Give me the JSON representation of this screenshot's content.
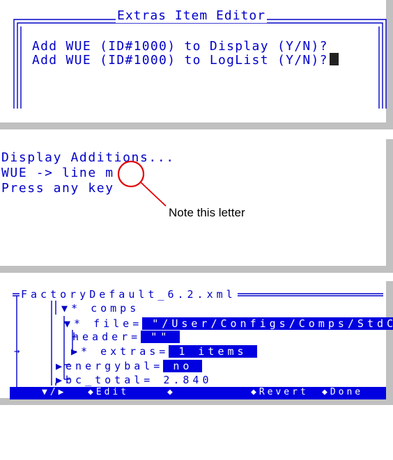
{
  "panel1": {
    "title": "Extras Item Editor",
    "line1": "Add WUE (ID#1000) to Display (Y/N)?",
    "line2": "Add WUE (ID#1000) to LogList (Y/N)?"
  },
  "panel2": {
    "line1": "Display Additions...",
    "line2_prefix": "WUE -> line ",
    "line2_letter": "m",
    "line3": "Press any key",
    "annotation": "Note this letter"
  },
  "panel3": {
    "title": "FactoryDefault_6.2.xml",
    "comps_label": "▼* comps",
    "file_label": "▼* file=",
    "file_value": " \"/User/Configs/Comps/StdCo",
    "header_label": "header=",
    "header_value": " \"\" ",
    "extras_label": "▶* extras=",
    "extras_value": " 1 items ",
    "energybal_label": "▶energybal=",
    "energybal_value": " no ",
    "bc_total_label": "▶bc_total=",
    "bc_total_value": " 2.840",
    "cursor_arrow": "→",
    "footer": {
      "toggle": "▼/▶",
      "edit": "◆Edit",
      "diamond": "◆",
      "revert": "◆Revert",
      "done": "◆Done"
    }
  }
}
